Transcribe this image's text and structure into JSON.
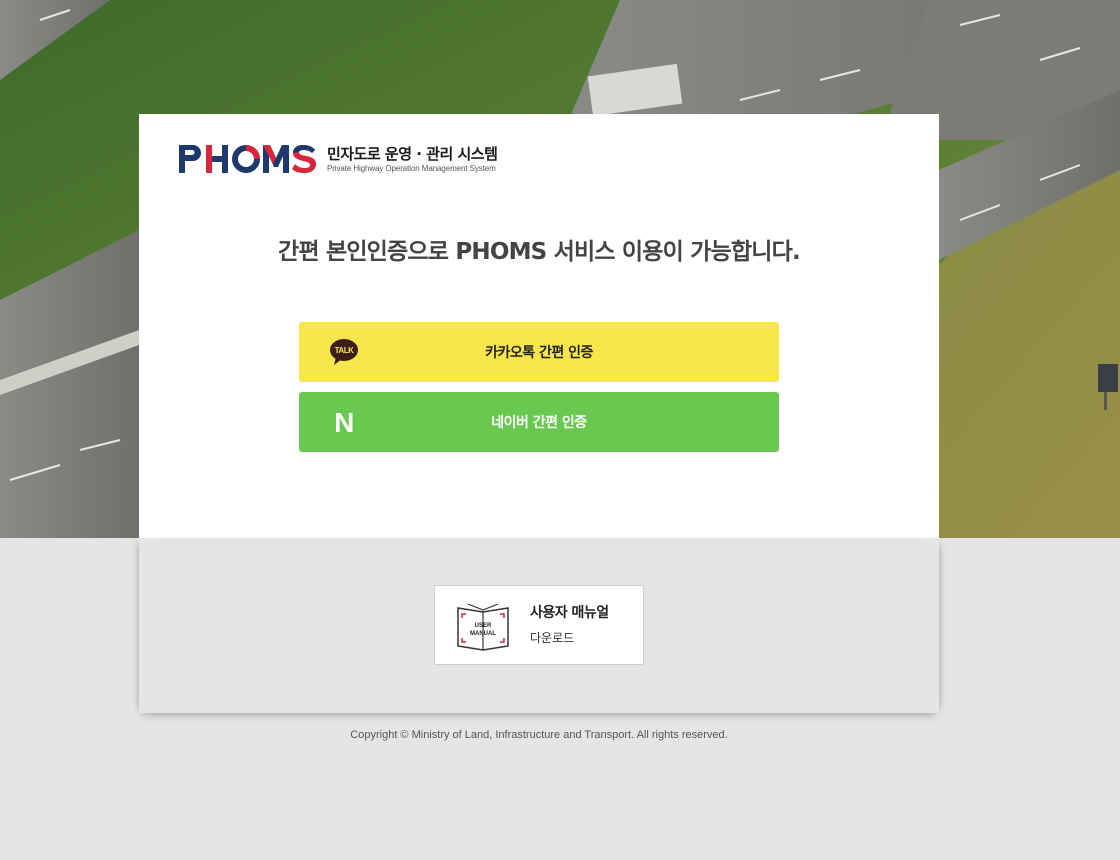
{
  "logo": {
    "mark_letters": [
      "P",
      "H",
      "O",
      "M",
      "S"
    ],
    "title_kr": "민자도로 운영 · 관리 시스템",
    "subtitle_en": "Private Highway Operation Management System"
  },
  "headline": "간편 본인인증으로 PHOMS 서비스 이용이 가능합니다.",
  "auth": {
    "kakao": {
      "label": "카카오톡 간편 인증",
      "icon": "kakao-talk-icon",
      "icon_text": "TALK",
      "color": "#f9e64a"
    },
    "naver": {
      "label": "네이버 간편 인증",
      "icon": "naver-icon",
      "icon_text": "N",
      "color": "#68c84f"
    }
  },
  "manual": {
    "title": "사용자 매뉴얼",
    "subtitle": "다운로드",
    "icon": "user-manual-book-icon",
    "icon_text_line1": "USER",
    "icon_text_line2": "MANUAL"
  },
  "copyright": "Copyright © Ministry of Land, Infrastructure and Transport. All rights reserved."
}
